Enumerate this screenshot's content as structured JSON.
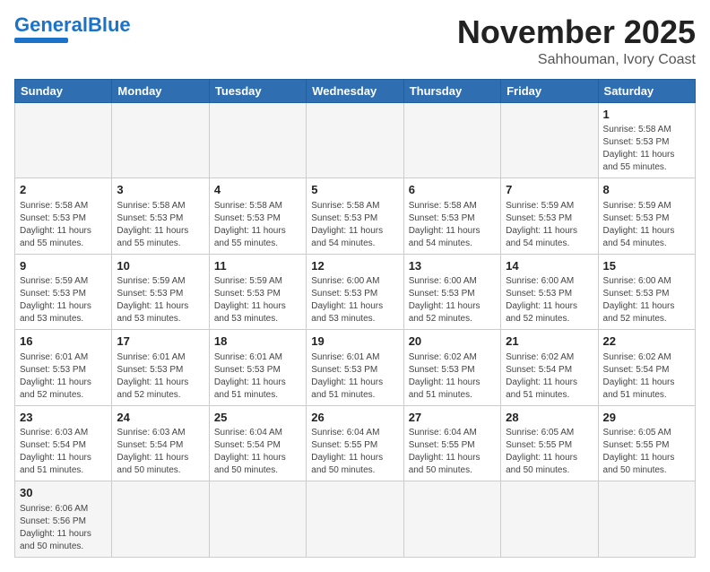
{
  "header": {
    "logo_general": "General",
    "logo_blue": "Blue",
    "month_title": "November 2025",
    "location": "Sahhouman, Ivory Coast"
  },
  "weekdays": [
    "Sunday",
    "Monday",
    "Tuesday",
    "Wednesday",
    "Thursday",
    "Friday",
    "Saturday"
  ],
  "weeks": [
    [
      {
        "day": "",
        "info": ""
      },
      {
        "day": "",
        "info": ""
      },
      {
        "day": "",
        "info": ""
      },
      {
        "day": "",
        "info": ""
      },
      {
        "day": "",
        "info": ""
      },
      {
        "day": "",
        "info": ""
      },
      {
        "day": "1",
        "info": "Sunrise: 5:58 AM\nSunset: 5:53 PM\nDaylight: 11 hours\nand 55 minutes."
      }
    ],
    [
      {
        "day": "2",
        "info": "Sunrise: 5:58 AM\nSunset: 5:53 PM\nDaylight: 11 hours\nand 55 minutes."
      },
      {
        "day": "3",
        "info": "Sunrise: 5:58 AM\nSunset: 5:53 PM\nDaylight: 11 hours\nand 55 minutes."
      },
      {
        "day": "4",
        "info": "Sunrise: 5:58 AM\nSunset: 5:53 PM\nDaylight: 11 hours\nand 55 minutes."
      },
      {
        "day": "5",
        "info": "Sunrise: 5:58 AM\nSunset: 5:53 PM\nDaylight: 11 hours\nand 54 minutes."
      },
      {
        "day": "6",
        "info": "Sunrise: 5:58 AM\nSunset: 5:53 PM\nDaylight: 11 hours\nand 54 minutes."
      },
      {
        "day": "7",
        "info": "Sunrise: 5:59 AM\nSunset: 5:53 PM\nDaylight: 11 hours\nand 54 minutes."
      },
      {
        "day": "8",
        "info": "Sunrise: 5:59 AM\nSunset: 5:53 PM\nDaylight: 11 hours\nand 54 minutes."
      }
    ],
    [
      {
        "day": "9",
        "info": "Sunrise: 5:59 AM\nSunset: 5:53 PM\nDaylight: 11 hours\nand 53 minutes."
      },
      {
        "day": "10",
        "info": "Sunrise: 5:59 AM\nSunset: 5:53 PM\nDaylight: 11 hours\nand 53 minutes."
      },
      {
        "day": "11",
        "info": "Sunrise: 5:59 AM\nSunset: 5:53 PM\nDaylight: 11 hours\nand 53 minutes."
      },
      {
        "day": "12",
        "info": "Sunrise: 6:00 AM\nSunset: 5:53 PM\nDaylight: 11 hours\nand 53 minutes."
      },
      {
        "day": "13",
        "info": "Sunrise: 6:00 AM\nSunset: 5:53 PM\nDaylight: 11 hours\nand 52 minutes."
      },
      {
        "day": "14",
        "info": "Sunrise: 6:00 AM\nSunset: 5:53 PM\nDaylight: 11 hours\nand 52 minutes."
      },
      {
        "day": "15",
        "info": "Sunrise: 6:00 AM\nSunset: 5:53 PM\nDaylight: 11 hours\nand 52 minutes."
      }
    ],
    [
      {
        "day": "16",
        "info": "Sunrise: 6:01 AM\nSunset: 5:53 PM\nDaylight: 11 hours\nand 52 minutes."
      },
      {
        "day": "17",
        "info": "Sunrise: 6:01 AM\nSunset: 5:53 PM\nDaylight: 11 hours\nand 52 minutes."
      },
      {
        "day": "18",
        "info": "Sunrise: 6:01 AM\nSunset: 5:53 PM\nDaylight: 11 hours\nand 51 minutes."
      },
      {
        "day": "19",
        "info": "Sunrise: 6:01 AM\nSunset: 5:53 PM\nDaylight: 11 hours\nand 51 minutes."
      },
      {
        "day": "20",
        "info": "Sunrise: 6:02 AM\nSunset: 5:53 PM\nDaylight: 11 hours\nand 51 minutes."
      },
      {
        "day": "21",
        "info": "Sunrise: 6:02 AM\nSunset: 5:54 PM\nDaylight: 11 hours\nand 51 minutes."
      },
      {
        "day": "22",
        "info": "Sunrise: 6:02 AM\nSunset: 5:54 PM\nDaylight: 11 hours\nand 51 minutes."
      }
    ],
    [
      {
        "day": "23",
        "info": "Sunrise: 6:03 AM\nSunset: 5:54 PM\nDaylight: 11 hours\nand 51 minutes."
      },
      {
        "day": "24",
        "info": "Sunrise: 6:03 AM\nSunset: 5:54 PM\nDaylight: 11 hours\nand 50 minutes."
      },
      {
        "day": "25",
        "info": "Sunrise: 6:04 AM\nSunset: 5:54 PM\nDaylight: 11 hours\nand 50 minutes."
      },
      {
        "day": "26",
        "info": "Sunrise: 6:04 AM\nSunset: 5:55 PM\nDaylight: 11 hours\nand 50 minutes."
      },
      {
        "day": "27",
        "info": "Sunrise: 6:04 AM\nSunset: 5:55 PM\nDaylight: 11 hours\nand 50 minutes."
      },
      {
        "day": "28",
        "info": "Sunrise: 6:05 AM\nSunset: 5:55 PM\nDaylight: 11 hours\nand 50 minutes."
      },
      {
        "day": "29",
        "info": "Sunrise: 6:05 AM\nSunset: 5:55 PM\nDaylight: 11 hours\nand 50 minutes."
      }
    ],
    [
      {
        "day": "30",
        "info": "Sunrise: 6:06 AM\nSunset: 5:56 PM\nDaylight: 11 hours\nand 50 minutes."
      },
      {
        "day": "",
        "info": ""
      },
      {
        "day": "",
        "info": ""
      },
      {
        "day": "",
        "info": ""
      },
      {
        "day": "",
        "info": ""
      },
      {
        "day": "",
        "info": ""
      },
      {
        "day": "",
        "info": ""
      }
    ]
  ]
}
